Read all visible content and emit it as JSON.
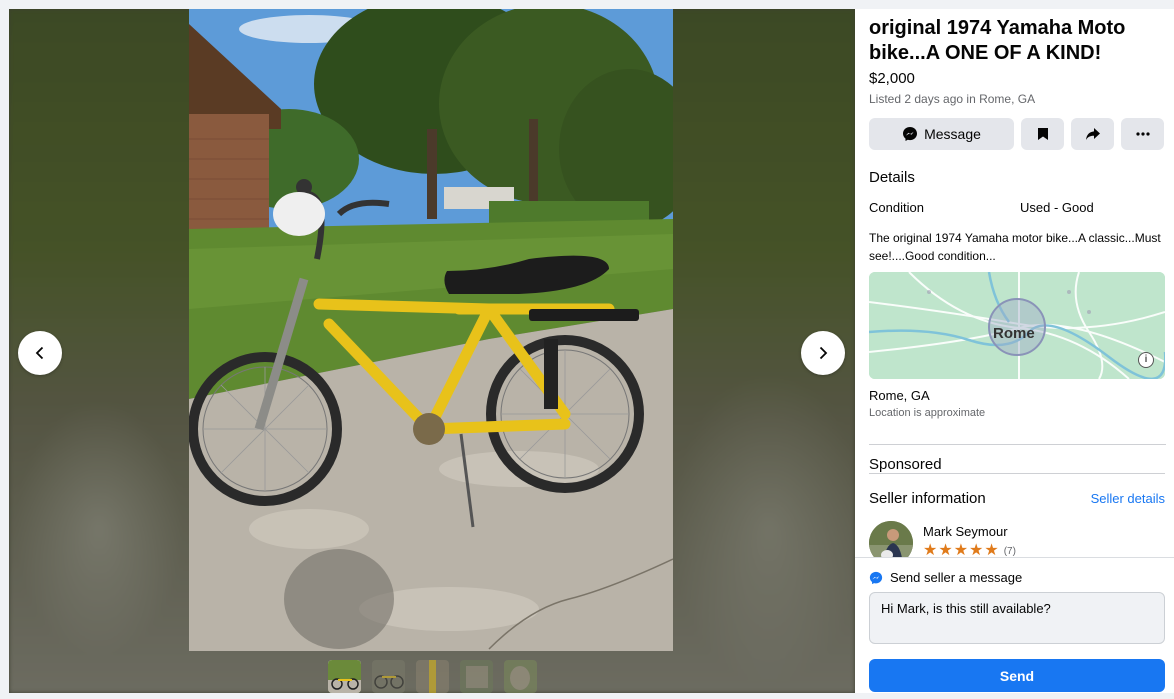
{
  "listing": {
    "title": "original 1974 Yamaha Moto bike...A ONE OF A KIND!",
    "price": "$2,000",
    "listed": "Listed 2 days ago in Rome, GA"
  },
  "actions": {
    "message_label": "Message"
  },
  "details": {
    "heading": "Details",
    "condition_label": "Condition",
    "condition_value": "Used - Good",
    "description": "The original 1974 Yamaha motor bike...A classic...Must see!....Good condition..."
  },
  "map": {
    "city_label": "Rome",
    "location": "Rome, GA",
    "location_note": "Location is approximate"
  },
  "sponsored": "Sponsored",
  "seller": {
    "heading": "Seller information",
    "details_link": "Seller details",
    "name": "Mark Seymour",
    "rating": 5,
    "rating_count": "(7)"
  },
  "composer": {
    "heading": "Send seller a message",
    "message_value": "Hi Mark, is this still available?",
    "send_label": "Send"
  },
  "media": {
    "thumbnail_count": 5,
    "active_thumbnail": 1
  },
  "colors": {
    "accent": "#1877f2",
    "star": "#e07b1b",
    "button_bg": "#e4e6eb"
  }
}
